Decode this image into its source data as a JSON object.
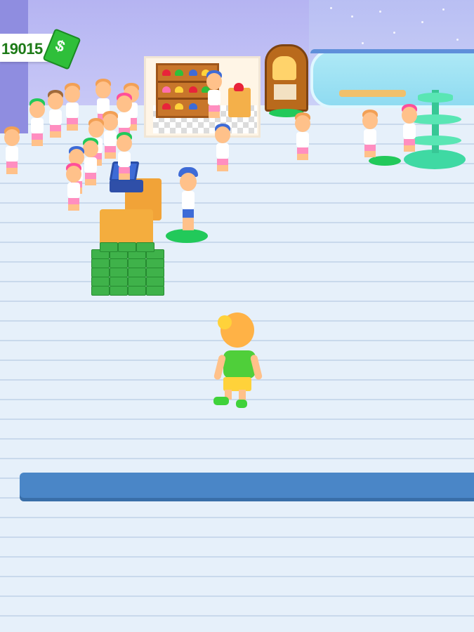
{
  "hud": {
    "money_value": "19015",
    "money_icon": "dollar-bill-icon",
    "money_icon_glyph": "$"
  },
  "colors": {
    "money_text": "#1d7a17",
    "accent_green": "#2fbf3a",
    "floor": "#e6f0fa",
    "divider": "#4a86c7"
  }
}
